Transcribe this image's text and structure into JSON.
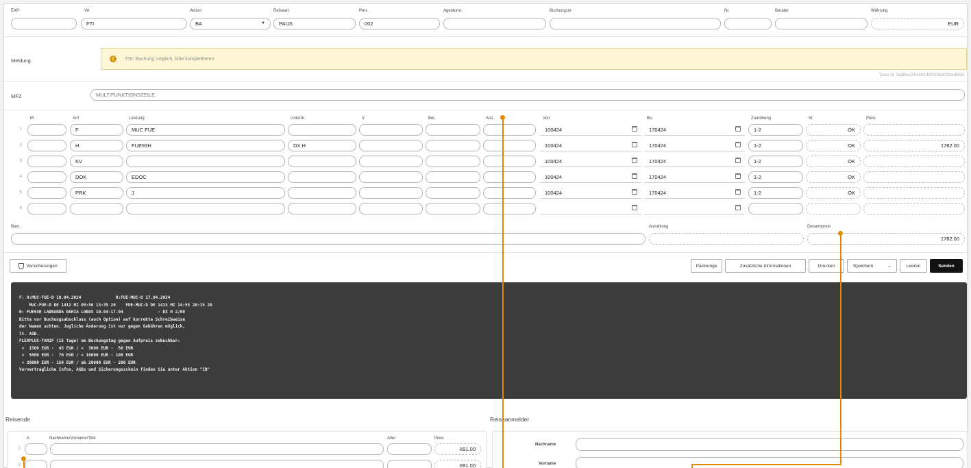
{
  "header": {
    "labels": [
      "EXP",
      "VA",
      "Aktion",
      "Reiseart",
      "Pers.",
      "Agenturnr.",
      "Buchungsnr",
      "Nr.",
      "Berater",
      "Währung"
    ],
    "exp": "",
    "va": "FTI",
    "aktion": "BA",
    "reiseart": "PAUS",
    "pers": "002",
    "agenturnr": "",
    "buchungsnr": "",
    "nr": "",
    "berater": "",
    "waehrung": "EUR"
  },
  "meldung": {
    "label": "Meldung",
    "text": "726: Buchung möglich, bitte komplettieren",
    "trace": "Trace Id: 3ad65c2104493d2307dc8f283e4bf55"
  },
  "mfz": {
    "label": "MFZ",
    "value": "MULTIFUNKTIONSZEILE"
  },
  "grid": {
    "headers": [
      "M",
      "Anf",
      "Leistung",
      "Unterbr.",
      "V",
      "Bel.",
      "Anz.",
      "Von",
      "Bis",
      "Zuordnung",
      "St",
      "Preis"
    ],
    "rows": [
      {
        "num": "1",
        "m": "",
        "anf": "F",
        "leistung": "MUC FUE",
        "unterbr": "",
        "v": "",
        "bel": "",
        "anz": "",
        "von": "100424",
        "bis": "170424",
        "zuordnung": "1-2",
        "st": "OK",
        "preis": ""
      },
      {
        "num": "2",
        "m": "",
        "anf": "H",
        "leistung": "FUE93H",
        "unterbr": "DX H",
        "v": "",
        "bel": "",
        "anz": "",
        "von": "100424",
        "bis": "170424",
        "zuordnung": "1-2",
        "st": "OK",
        "preis": "1782.00"
      },
      {
        "num": "3",
        "m": "",
        "anf": "KV",
        "leistung": "",
        "unterbr": "",
        "v": "",
        "bel": "",
        "anz": "",
        "von": "100424",
        "bis": "170424",
        "zuordnung": "1-2",
        "st": "OK",
        "preis": ""
      },
      {
        "num": "4",
        "m": "",
        "anf": "DOK",
        "leistung": "EDOC",
        "unterbr": "",
        "v": "",
        "bel": "",
        "anz": "",
        "von": "100424",
        "bis": "170424",
        "zuordnung": "1-2",
        "st": "OK",
        "preis": ""
      },
      {
        "num": "5",
        "m": "",
        "anf": "PRK",
        "leistung": "J",
        "unterbr": "",
        "v": "",
        "bel": "",
        "anz": "",
        "von": "100424",
        "bis": "170424",
        "zuordnung": "1-2",
        "st": "OK",
        "preis": ""
      },
      {
        "num": "6",
        "m": "",
        "anf": "",
        "leistung": "",
        "unterbr": "",
        "v": "",
        "bel": "",
        "anz": "",
        "von": "",
        "bis": "",
        "zuordnung": "",
        "st": "",
        "preis": ""
      }
    ]
  },
  "summary": {
    "bem_label": "Bem.",
    "bem": "",
    "anzahlung_label": "Anzahlung",
    "anzahlung": "",
    "gesamtpreis_label": "Gesamtpreis",
    "gesamtpreis": "1782.00"
  },
  "actions": {
    "versicherungen": "Versicherungen",
    "paxlounge": "Paxlounge",
    "zusatz": "Zusätzliche Informationen",
    "drucken": "Drucken",
    "speichern": "Speichern",
    "leeren": "Leeren",
    "senden": "Senden"
  },
  "terminal": {
    "lines": [
      "F: H:MUC-FUE-D 10.04.2024              R:FUE-MUC-D 17.04.2024",
      "    MUC-FUE-D DE 1412 MI 09:50 13:35 20    FUE-MUC-D DE 1413 MI 14:55 20:15 20",
      "H: FUE93H LABRANDA BAHIA LOBOS 10.04-17.04              - DX H 2/00",
      "Bitte vor Buchungsabschluss (auch Option) auf korrekte Schreibweise",
      "der Namen achten. Jegliche Änderung ist nur gegen Gebühren möglich,",
      "lt. AGB.",
      "FLEXPLUS-TARIF (15 Tage) am Buchungstag gegen Aufpreis zubuchbar:",
      " <  1500 EUR -  45 EUR / <  3000 EUR -  50 EUR",
      " <  5000 EUR -  70 EUR / < 10000 EUR - 100 EUR",
      " < 20000 EUR - 150 EUR / ab 20000 EUR - 200 EUR",
      "Vorvertragliche Infos, AGBs und Sicherungsschein finden Sie unter Aktion \"IB\""
    ]
  },
  "reisende": {
    "title": "Reisende",
    "headers": [
      "A",
      "Nachname/Vorname/Titel",
      "Alter",
      "Preis"
    ],
    "rows": [
      {
        "num": "1",
        "a": "",
        "name": "",
        "alter": "",
        "preis": "891.00"
      },
      {
        "num": "2",
        "a": "",
        "name": "",
        "alter": "",
        "preis": "891.00"
      }
    ]
  },
  "anmelder": {
    "title": "Reiseanmelder",
    "nachname_label": "Nachname",
    "vorname_label": "Vorname",
    "nachname": "",
    "vorname": ""
  },
  "colors": {
    "accent": "#e08a00",
    "alert_bg": "#fdf7d6",
    "terminal_bg": "#3c3c3c"
  }
}
